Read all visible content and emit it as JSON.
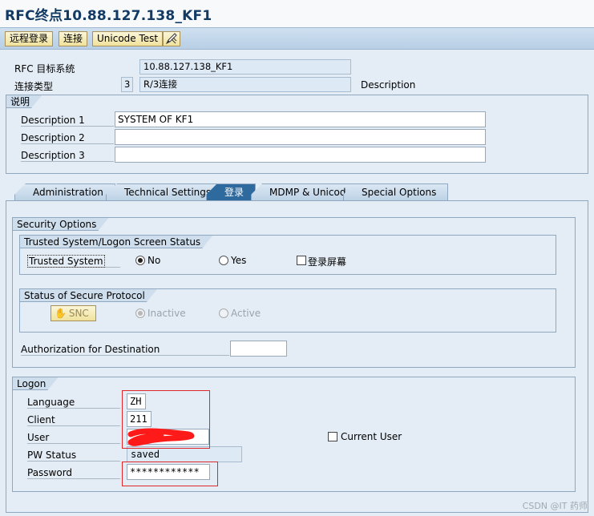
{
  "window": {
    "title": "RFC终点10.88.127.138_KF1"
  },
  "toolbar": {
    "remote_logon": "远程登录",
    "connect": "连接",
    "unicode_test": "Unicode Test",
    "pen_icon": "pen-icon"
  },
  "header": {
    "rfc_dest_label": "RFC 目标系统",
    "rfc_dest_value": "10.88.127.138_KF1",
    "conn_type_label": "连接类型",
    "conn_type_code": "3",
    "conn_type_value": "R/3连接",
    "conn_type_desc": "Description"
  },
  "description": {
    "title": "说明",
    "d1_label": "Description 1",
    "d1_value": "SYSTEM OF KF1",
    "d2_label": "Description 2",
    "d2_value": "",
    "d3_label": "Description 3",
    "d3_value": ""
  },
  "tabs": [
    {
      "label": "Administration",
      "active": false
    },
    {
      "label": "Technical Settings",
      "active": false
    },
    {
      "label": "登录",
      "active": true
    },
    {
      "label": "MDMP & Unicode",
      "active": false
    },
    {
      "label": "Special Options",
      "active": false
    }
  ],
  "security": {
    "title": "Security Options",
    "trusted_group_title": "Trusted System/Logon Screen Status",
    "trusted_label": "Trusted System",
    "no_label": "No",
    "yes_label": "Yes",
    "logon_screen_label": "登录屏幕",
    "trusted_selected": "No",
    "protocol_group_title": "Status of Secure Protocol",
    "snc_label": "SNC",
    "inactive_label": "Inactive",
    "active_label": "Active",
    "protocol_selected": "Inactive",
    "auth_label": "Authorization for Destination",
    "auth_value": ""
  },
  "logon": {
    "title": "Logon",
    "language_label": "Language",
    "language_value": "ZH",
    "client_label": "Client",
    "client_value": "211",
    "user_label": "User",
    "pw_status_label": "PW Status",
    "pw_status_value": "saved",
    "password_label": "Password",
    "password_value": "************",
    "current_user_label": "Current User"
  },
  "watermark": "CSDN @IT 药师",
  "colors": {
    "accent": "#2f6a9e",
    "highlight": "#e0282a",
    "redaction": "#ff1a1a"
  }
}
